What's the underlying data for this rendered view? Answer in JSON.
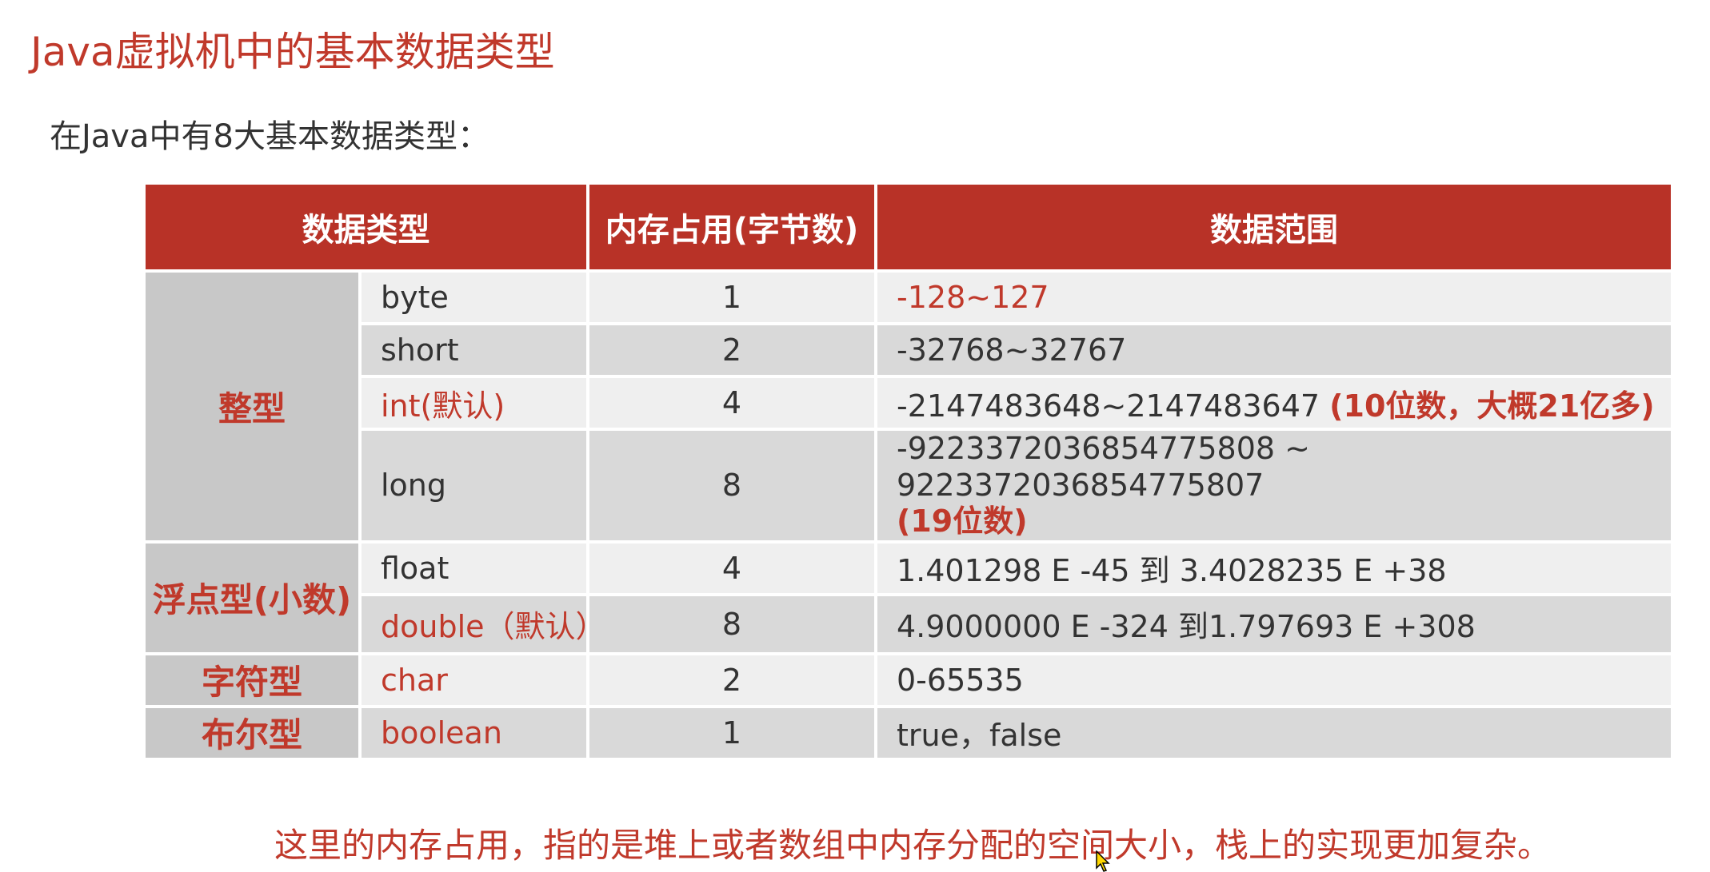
{
  "title": "Java虚拟机中的基本数据类型",
  "intro": "在Java中有8大基本数据类型：",
  "table": {
    "headers": [
      "数据类型",
      "内存占用(字节数)",
      "数据范围"
    ],
    "groups": {
      "integer": "整型",
      "float": "浮点型(小数)",
      "char": "字符型",
      "boolean": "布尔型"
    },
    "rows": [
      {
        "type": "byte",
        "bytes": "1",
        "range": "-128~127",
        "note": ""
      },
      {
        "type": "short",
        "bytes": "2",
        "range": "-32768~32767",
        "note": ""
      },
      {
        "type": "int(默认)",
        "bytes": "4",
        "range": "-2147483648~2147483647 ",
        "note": "(10位数，大概21亿多)"
      },
      {
        "type": "long",
        "bytes": "8",
        "range": "-9223372036854775808 ~ 9223372036854775807",
        "note": "(19位数)"
      },
      {
        "type": "float",
        "bytes": "4",
        "range": "1.401298 E -45 到 3.4028235 E +38",
        "note": ""
      },
      {
        "type": "double（默认）",
        "bytes": "8",
        "range": "4.9000000 E -324 到1.797693 E +308",
        "note": ""
      },
      {
        "type": "char",
        "bytes": "2",
        "range": "0-65535",
        "note": ""
      },
      {
        "type": "boolean",
        "bytes": "1",
        "range": "true，false",
        "note": ""
      }
    ]
  },
  "footer_note": "这里的内存占用，指的是堆上或者数组中内存分配的空间大小，栈上的实现更加复杂。",
  "colors": {
    "accent_red": "#c0392b",
    "header_bg": "#b83227",
    "row_light": "#efefef",
    "row_dark": "#d9d9d9",
    "group_bg": "#c8c8c8"
  },
  "icons": {
    "cursor": "mouse-pointer-icon"
  }
}
